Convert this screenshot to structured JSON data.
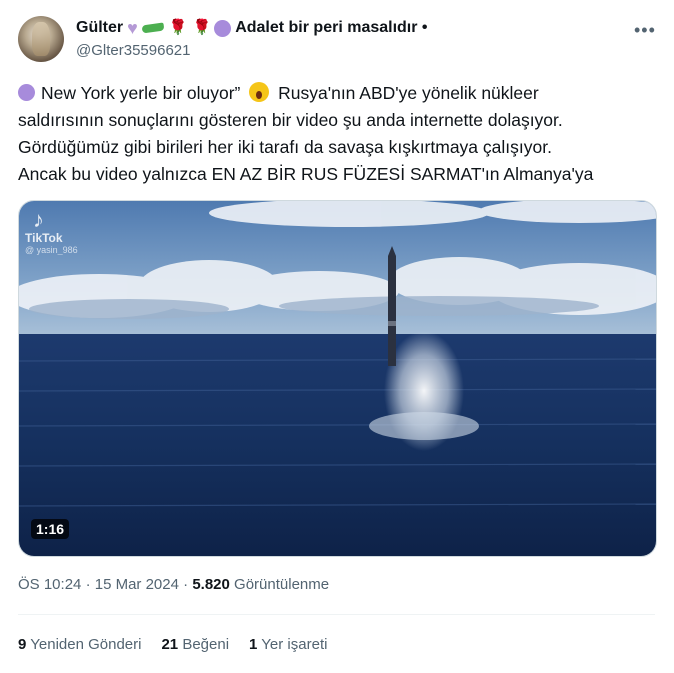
{
  "author": {
    "display_name": "Gülter",
    "name_suffix": "Adalet bir peri masalıdır •",
    "handle": "@Glter35596621"
  },
  "icons": {
    "more": "more-options-icon",
    "heart": "purple-heart-emoji",
    "pepper": "green-pepper-emoji",
    "rose": "rose-emoji",
    "circle": "purple-circle-emoji",
    "scream": "screaming-face-emoji"
  },
  "colors": {
    "text": "#0f1419",
    "secondary": "#536471",
    "purple_circle": "#a78bdb"
  },
  "tweet": {
    "lines": [
      "New York yerle bir oluyor”",
      "Rusya'nın ABD'ye yönelik nükleer",
      "saldırısının sonuçlarını gösteren bir video şu anda internette dolaşıyor.",
      "Gördüğümüz gibi birileri her iki tarafı da savaşa kışkırtmaya çalışıyor.",
      "Ancak bu video yalnızca EN AZ BİR RUS FÜZESİ SARMAT'ın Almanya'ya"
    ]
  },
  "media": {
    "watermark_brand": "TikTok",
    "watermark_user": "@ yasin_986",
    "duration": "1:16"
  },
  "meta": {
    "time": "ÖS 10:24",
    "separator": "·",
    "date": "15 Mar 2024",
    "views_count": "5.820",
    "views_label": "Görüntülenme"
  },
  "stats": {
    "retweets_count": "9",
    "retweets_label": "Yeniden Gönderi",
    "likes_count": "21",
    "likes_label": "Beğeni",
    "bookmarks_count": "1",
    "bookmarks_label": "Yer işareti"
  }
}
